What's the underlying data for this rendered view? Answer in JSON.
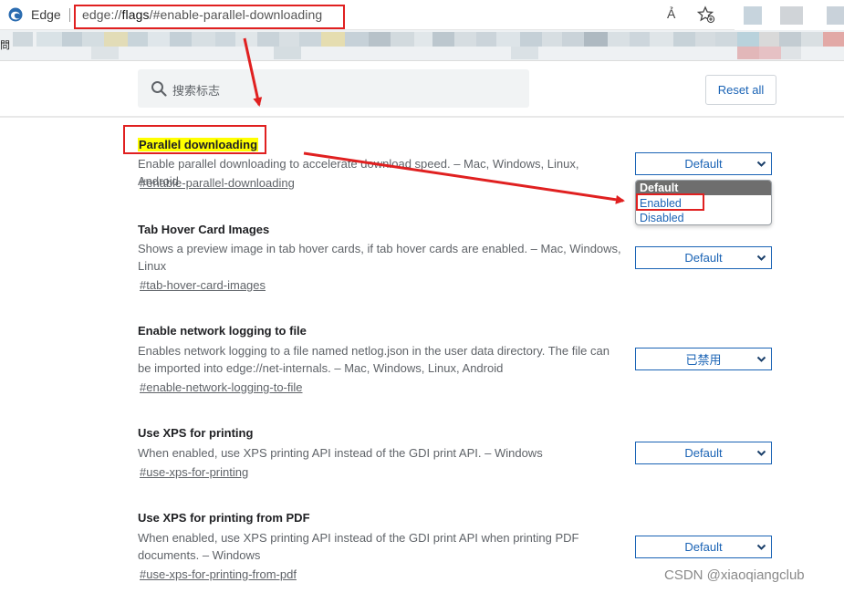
{
  "browser": {
    "name": "Edge",
    "url_scheme": "edge://",
    "url_host": "flags",
    "url_path": "/#enable-parallel-downloading",
    "read_aloud_label": "Ả"
  },
  "favorites_bar": {
    "fragment": "問"
  },
  "header": {
    "search_placeholder": "搜索标志",
    "reset_label": "Reset all"
  },
  "experiments": [
    {
      "title": "Parallel downloading",
      "description": "Enable parallel downloading to accelerate download speed. – Mac, Windows, Linux, Android",
      "link": "#enable-parallel-downloading",
      "value": "Default"
    },
    {
      "title": "Tab Hover Card Images",
      "description": "Shows a preview image in tab hover cards, if tab hover cards are enabled. – Mac, Windows, Linux",
      "link": "#tab-hover-card-images",
      "value": "Default"
    },
    {
      "title": "Enable network logging to file",
      "description": "Enables network logging to a file named netlog.json in the user data directory. The file can be imported into edge://net-internals. – Mac, Windows, Linux, Android",
      "link": "#enable-network-logging-to-file",
      "value": "已禁用"
    },
    {
      "title": "Use XPS for printing",
      "description": "When enabled, use XPS printing API instead of the GDI print API. – Windows",
      "link": "#use-xps-for-printing",
      "value": "Default"
    },
    {
      "title": "Use XPS for printing from PDF",
      "description": "When enabled, use XPS printing API instead of the GDI print API when printing PDF documents. – Windows",
      "link": "#use-xps-for-printing-from-pdf",
      "value": "Default"
    }
  ],
  "dropdown": {
    "options": [
      "Default",
      "Enabled",
      "Disabled"
    ],
    "highlighted": "Default"
  },
  "watermark": "CSDN @xiaoqiangclub",
  "colors": {
    "accent": "#1a63b5",
    "annotation": "#e02020",
    "highlight": "#ffff00"
  },
  "icons": [
    "edge-logo-icon",
    "read-aloud-icon",
    "add-favorite-icon",
    "search-icon",
    "chevron-down-icon"
  ]
}
